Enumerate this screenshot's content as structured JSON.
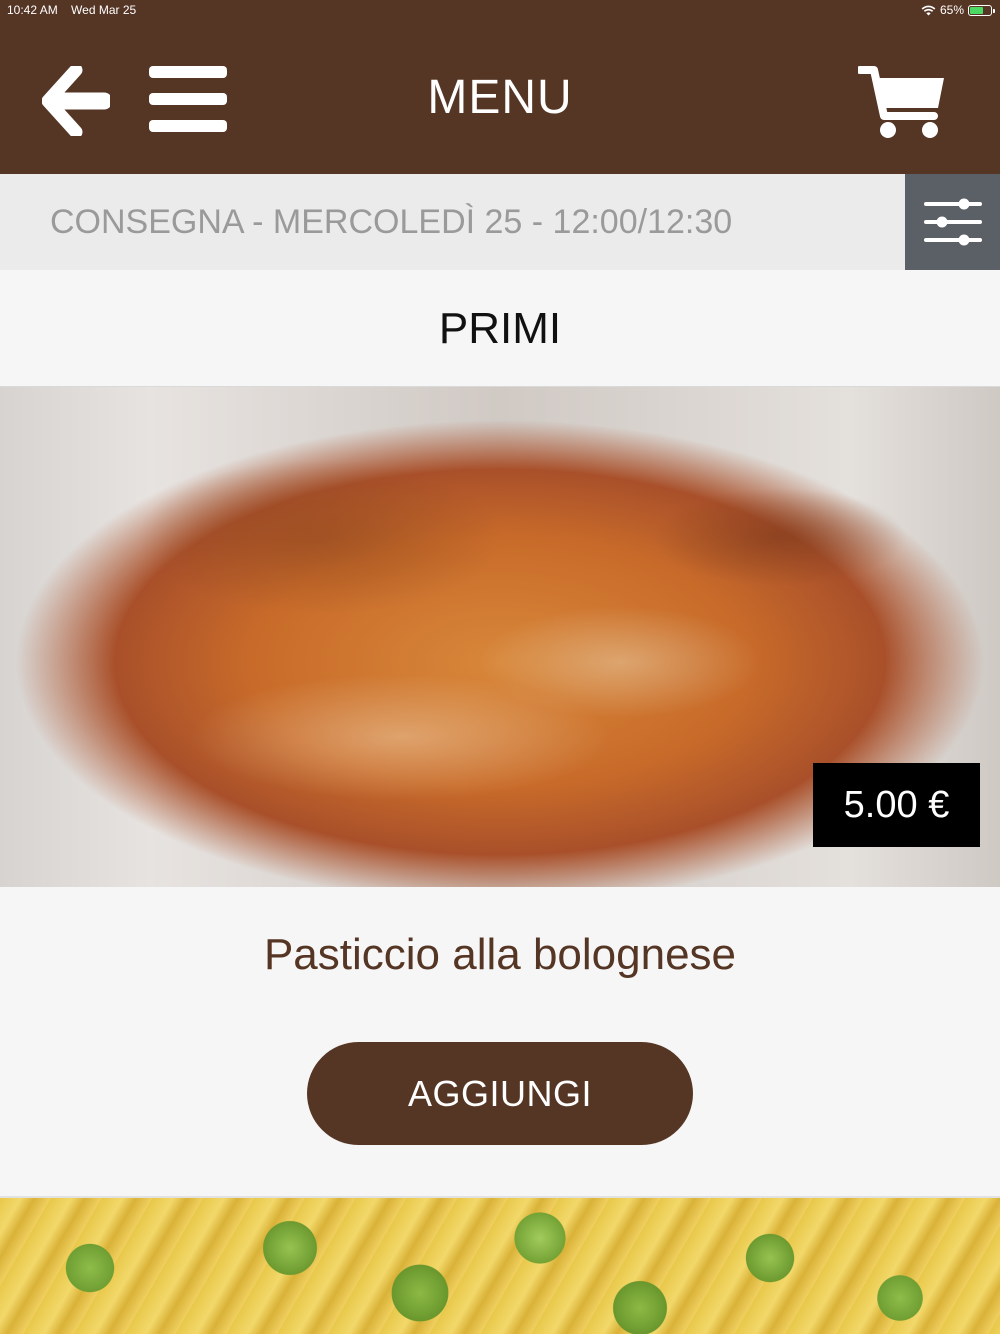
{
  "status_bar": {
    "time": "10:42 AM",
    "date": "Wed Mar 25",
    "battery_percent": "65%",
    "battery_level": 0.65,
    "wifi_icon": "wifi-icon"
  },
  "header": {
    "title": "MENU",
    "back_icon": "arrow-left-icon",
    "menu_icon": "hamburger-icon",
    "cart_icon": "cart-icon",
    "background_color": "#553524"
  },
  "delivery": {
    "label": "CONSEGNA - MERCOLEDÌ 25 - 12:00/12:30",
    "filter_icon": "sliders-icon"
  },
  "category": {
    "title": "PRIMI"
  },
  "products": [
    {
      "name": "Pasticcio alla bolognese",
      "price": "5.00 €",
      "add_label": "AGGIUNGI"
    }
  ],
  "colors": {
    "brand": "#553524",
    "delivery_bar": "#ebebeb",
    "filter_button": "#5b5f66",
    "price_badge": "#000000"
  }
}
